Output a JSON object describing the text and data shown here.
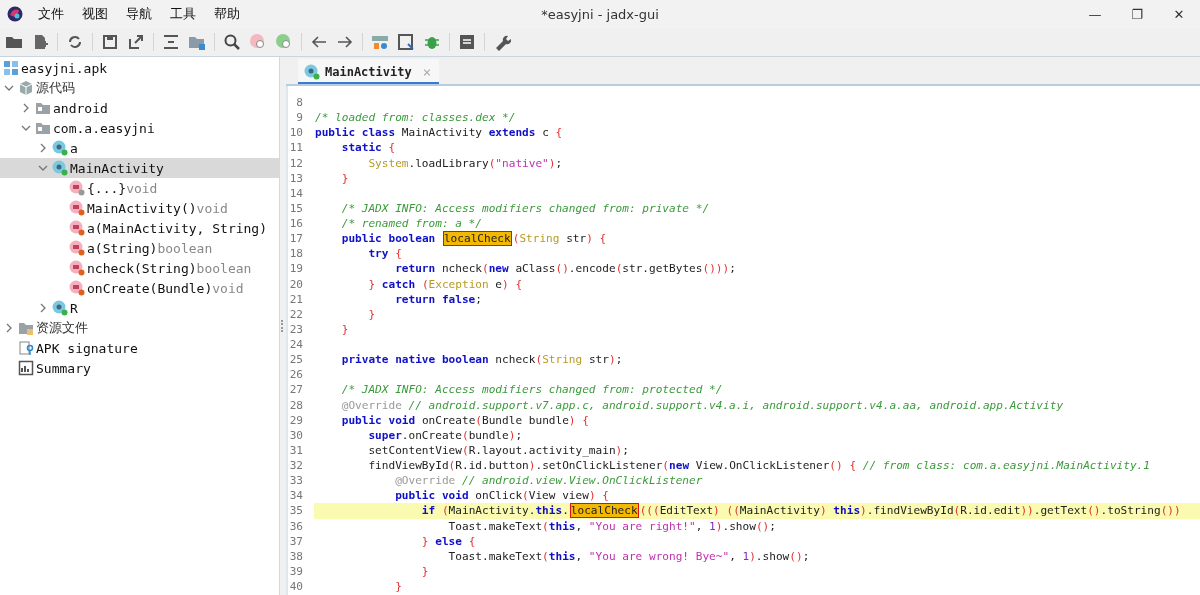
{
  "window": {
    "title": "*easyjni - jadx-gui",
    "controls": [
      "—",
      "❐",
      "✕"
    ]
  },
  "menu": [
    "文件",
    "视图",
    "导航",
    "工具",
    "帮助"
  ],
  "tree": {
    "root": {
      "label": "easyjni.apk"
    },
    "items": [
      {
        "label": "源代码",
        "kind": "source",
        "expanded": true,
        "selected": false,
        "children": [
          {
            "label": "android",
            "kind": "package",
            "expanded": false,
            "selected": false
          },
          {
            "label": "com.a.easyjni",
            "kind": "package",
            "expanded": true,
            "selected": false,
            "children": [
              {
                "label": "a",
                "kind": "class",
                "expanded": false,
                "selected": false
              },
              {
                "label": "MainActivity",
                "kind": "class",
                "expanded": true,
                "selected": true,
                "children": [
                  {
                    "label": "{...}",
                    "type_hint": "void",
                    "kind": "init",
                    "selected": false
                  },
                  {
                    "label": "MainActivity()",
                    "type_hint": "void",
                    "kind": "method",
                    "selected": false
                  },
                  {
                    "label": "a(MainActivity, String)",
                    "kind": "method",
                    "selected": false
                  },
                  {
                    "label": "a(String)",
                    "type_hint": "boolean",
                    "kind": "method",
                    "selected": false
                  },
                  {
                    "label": "ncheck(String)",
                    "type_hint": "boolean",
                    "kind": "method",
                    "selected": false
                  },
                  {
                    "label": "onCreate(Bundle)",
                    "type_hint": "void",
                    "kind": "method",
                    "selected": false
                  }
                ]
              },
              {
                "label": "R",
                "kind": "class",
                "expanded": false,
                "selected": false
              }
            ]
          }
        ]
      },
      {
        "label": "资源文件",
        "kind": "resources",
        "expanded": false,
        "selected": false
      },
      {
        "label": "APK signature",
        "kind": "signature",
        "selected": false
      },
      {
        "label": "Summary",
        "kind": "summary",
        "selected": false
      }
    ]
  },
  "tabs": [
    {
      "label": "MainActivity",
      "close": "×",
      "selected": true
    }
  ],
  "code": {
    "lines": [
      {
        "number": "8",
        "current": false
      },
      {
        "number": "9",
        "current": false,
        "tokens": [
          {
            "kind": "comment",
            "text": "/* loaded from: classes.dex */"
          }
        ]
      },
      {
        "number": "10",
        "current": false,
        "tokens": [
          {
            "kind": "keyword",
            "text": "public "
          },
          {
            "kind": "keyword",
            "text": "class"
          },
          {
            "kind": "plain",
            "text": " MainActivity "
          },
          {
            "kind": "keyword",
            "text": "extends"
          },
          {
            "kind": "plain",
            "text": " c "
          },
          {
            "kind": "paren",
            "text": "{"
          }
        ]
      },
      {
        "number": "11",
        "current": false,
        "tokens": [
          {
            "kind": "keyword",
            "text": "    static "
          },
          {
            "kind": "paren",
            "text": "{"
          }
        ]
      },
      {
        "number": "12",
        "current": false,
        "tokens": [
          {
            "kind": "type",
            "text": "        System"
          },
          {
            "kind": "plain",
            "text": ".loadLibrary"
          },
          {
            "kind": "paren",
            "text": "("
          },
          {
            "kind": "string",
            "text": "\"native\""
          },
          {
            "kind": "paren",
            "text": ")"
          },
          {
            "kind": "plain",
            "text": ";"
          }
        ]
      },
      {
        "number": "13",
        "current": false,
        "tokens": [
          {
            "kind": "paren",
            "text": "    }"
          }
        ]
      },
      {
        "number": "14",
        "current": false
      },
      {
        "number": "15",
        "current": false,
        "tokens": [
          {
            "kind": "comment",
            "text": "    /* JADX INFO: Access modifiers changed from: private */"
          }
        ]
      },
      {
        "number": "16",
        "current": false,
        "tokens": [
          {
            "kind": "comment",
            "text": "    /* renamed from: a */"
          }
        ]
      },
      {
        "number": "17",
        "current": false,
        "tokens": [
          {
            "kind": "keyword",
            "text": "    public "
          },
          {
            "kind": "keyword",
            "text": "boolean "
          },
          {
            "kind": "match",
            "text": "localCheck"
          },
          {
            "kind": "paren",
            "text": "("
          },
          {
            "kind": "type",
            "text": "String"
          },
          {
            "kind": "plain",
            "text": " str"
          },
          {
            "kind": "paren",
            "text": ") {"
          }
        ]
      },
      {
        "number": "18",
        "current": false,
        "tokens": [
          {
            "kind": "keyword",
            "text": "        try "
          },
          {
            "kind": "paren",
            "text": "{"
          }
        ]
      },
      {
        "number": "19",
        "current": false,
        "tokens": [
          {
            "kind": "keyword",
            "text": "            return"
          },
          {
            "kind": "plain",
            "text": " ncheck"
          },
          {
            "kind": "paren",
            "text": "("
          },
          {
            "kind": "keyword",
            "text": "new"
          },
          {
            "kind": "plain",
            "text": " aClass"
          },
          {
            "kind": "paren",
            "text": "()"
          },
          {
            "kind": "plain",
            "text": ".encode"
          },
          {
            "kind": "paren",
            "text": "("
          },
          {
            "kind": "plain",
            "text": "str.getBytes"
          },
          {
            "kind": "paren",
            "text": "()))"
          },
          {
            "kind": "plain",
            "text": ";"
          }
        ]
      },
      {
        "number": "20",
        "current": false,
        "tokens": [
          {
            "kind": "paren",
            "text": "        } "
          },
          {
            "kind": "keyword",
            "text": "catch "
          },
          {
            "kind": "paren",
            "text": "("
          },
          {
            "kind": "type",
            "text": "Exception"
          },
          {
            "kind": "plain",
            "text": " e"
          },
          {
            "kind": "paren",
            "text": ") {"
          }
        ]
      },
      {
        "number": "21",
        "current": false,
        "tokens": [
          {
            "kind": "keyword",
            "text": "            return "
          },
          {
            "kind": "keyword",
            "text": "false"
          },
          {
            "kind": "plain",
            "text": ";"
          }
        ]
      },
      {
        "number": "22",
        "current": false,
        "tokens": [
          {
            "kind": "paren",
            "text": "        }"
          }
        ]
      },
      {
        "number": "23",
        "current": false,
        "tokens": [
          {
            "kind": "paren",
            "text": "    }"
          }
        ]
      },
      {
        "number": "24",
        "current": false
      },
      {
        "number": "25",
        "current": false,
        "tokens": [
          {
            "kind": "keyword",
            "text": "    private "
          },
          {
            "kind": "keyword",
            "text": "native "
          },
          {
            "kind": "keyword",
            "text": "boolean"
          },
          {
            "kind": "plain",
            "text": " ncheck"
          },
          {
            "kind": "paren",
            "text": "("
          },
          {
            "kind": "type",
            "text": "String"
          },
          {
            "kind": "plain",
            "text": " str"
          },
          {
            "kind": "paren",
            "text": ")"
          },
          {
            "kind": "plain",
            "text": ";"
          }
        ]
      },
      {
        "number": "26",
        "current": false
      },
      {
        "number": "27",
        "current": false,
        "tokens": [
          {
            "kind": "comment",
            "text": "    /* JADX INFO: Access modifiers changed from: protected */"
          }
        ]
      },
      {
        "number": "28",
        "current": false,
        "tokens": [
          {
            "kind": "annotation",
            "text": "    @Override "
          },
          {
            "kind": "comment",
            "text": "// android.support.v7.app.c, android.support.v4.a.i, android.support.v4.a.aa, android.app.Activity"
          }
        ]
      },
      {
        "number": "29",
        "current": false,
        "tokens": [
          {
            "kind": "keyword",
            "text": "    public "
          },
          {
            "kind": "keyword",
            "text": "void"
          },
          {
            "kind": "plain",
            "text": " onCreate"
          },
          {
            "kind": "paren",
            "text": "("
          },
          {
            "kind": "plain",
            "text": "Bundle bundle"
          },
          {
            "kind": "paren",
            "text": ") {"
          }
        ]
      },
      {
        "number": "30",
        "current": false,
        "tokens": [
          {
            "kind": "keyword",
            "text": "        super"
          },
          {
            "kind": "plain",
            "text": ".onCreate"
          },
          {
            "kind": "paren",
            "text": "("
          },
          {
            "kind": "plain",
            "text": "bundle"
          },
          {
            "kind": "paren",
            "text": ")"
          },
          {
            "kind": "plain",
            "text": ";"
          }
        ]
      },
      {
        "number": "31",
        "current": false,
        "tokens": [
          {
            "kind": "plain",
            "text": "        setContentView"
          },
          {
            "kind": "paren",
            "text": "("
          },
          {
            "kind": "plain",
            "text": "R.layout.activity_main"
          },
          {
            "kind": "paren",
            "text": ")"
          },
          {
            "kind": "plain",
            "text": ";"
          }
        ]
      },
      {
        "number": "32",
        "current": false,
        "tokens": [
          {
            "kind": "plain",
            "text": "        findViewById"
          },
          {
            "kind": "paren",
            "text": "("
          },
          {
            "kind": "plain",
            "text": "R.id.button"
          },
          {
            "kind": "paren",
            "text": ")"
          },
          {
            "kind": "plain",
            "text": ".setOnClickListener"
          },
          {
            "kind": "paren",
            "text": "("
          },
          {
            "kind": "keyword",
            "text": "new"
          },
          {
            "kind": "plain",
            "text": " View.OnClickListener"
          },
          {
            "kind": "paren",
            "text": "() { "
          },
          {
            "kind": "comment",
            "text": "// from class: com.a.easyjni.MainActivity.1"
          }
        ]
      },
      {
        "number": "33",
        "current": false,
        "tokens": [
          {
            "kind": "annotation",
            "text": "            @Override "
          },
          {
            "kind": "comment",
            "text": "// android.view.View.OnClickListener"
          }
        ]
      },
      {
        "number": "34",
        "current": false,
        "tokens": [
          {
            "kind": "keyword",
            "text": "            public "
          },
          {
            "kind": "keyword",
            "text": "void"
          },
          {
            "kind": "plain",
            "text": " onClick"
          },
          {
            "kind": "paren",
            "text": "("
          },
          {
            "kind": "plain",
            "text": "View view"
          },
          {
            "kind": "paren",
            "text": ") {"
          }
        ]
      },
      {
        "number": "35",
        "current": true,
        "tokens": [
          {
            "kind": "keyword",
            "text": "                if "
          },
          {
            "kind": "paren",
            "text": "("
          },
          {
            "kind": "plain",
            "text": "MainActivity."
          },
          {
            "kind": "keyword",
            "text": "this"
          },
          {
            "kind": "plain",
            "text": "."
          },
          {
            "kind": "match",
            "text": "localCheck"
          },
          {
            "kind": "paren",
            "text": "((("
          },
          {
            "kind": "plain",
            "text": "EditText"
          },
          {
            "kind": "paren",
            "text": ") (("
          },
          {
            "kind": "plain",
            "text": "MainActivity"
          },
          {
            "kind": "paren",
            "text": ") "
          },
          {
            "kind": "keyword",
            "text": "this"
          },
          {
            "kind": "paren",
            "text": ")"
          },
          {
            "kind": "plain",
            "text": ".findViewById"
          },
          {
            "kind": "paren",
            "text": "("
          },
          {
            "kind": "plain",
            "text": "R.id.edit"
          },
          {
            "kind": "paren",
            "text": "))"
          },
          {
            "kind": "plain",
            "text": ".getText"
          },
          {
            "kind": "paren",
            "text": "()"
          },
          {
            "kind": "plain",
            "text": ".toString"
          },
          {
            "kind": "paren",
            "text": "())"
          }
        ]
      },
      {
        "number": "36",
        "current": false,
        "tokens": [
          {
            "kind": "plain",
            "text": "                    Toast.makeText"
          },
          {
            "kind": "paren",
            "text": "("
          },
          {
            "kind": "keyword",
            "text": "this"
          },
          {
            "kind": "plain",
            "text": ", "
          },
          {
            "kind": "string",
            "text": "\"You are right!\""
          },
          {
            "kind": "plain",
            "text": ", "
          },
          {
            "kind": "number",
            "text": "1"
          },
          {
            "kind": "paren",
            "text": ")"
          },
          {
            "kind": "plain",
            "text": ".show"
          },
          {
            "kind": "paren",
            "text": "()"
          },
          {
            "kind": "plain",
            "text": ";"
          }
        ]
      },
      {
        "number": "37",
        "current": false,
        "tokens": [
          {
            "kind": "paren",
            "text": "                } "
          },
          {
            "kind": "keyword",
            "text": "else "
          },
          {
            "kind": "paren",
            "text": "{"
          }
        ]
      },
      {
        "number": "38",
        "current": false,
        "tokens": [
          {
            "kind": "plain",
            "text": "                    Toast.makeText"
          },
          {
            "kind": "paren",
            "text": "("
          },
          {
            "kind": "keyword",
            "text": "this"
          },
          {
            "kind": "plain",
            "text": ", "
          },
          {
            "kind": "string",
            "text": "\"You are wrong! Bye~\""
          },
          {
            "kind": "plain",
            "text": ", "
          },
          {
            "kind": "number",
            "text": "1"
          },
          {
            "kind": "paren",
            "text": ")"
          },
          {
            "kind": "plain",
            "text": ".show"
          },
          {
            "kind": "paren",
            "text": "()"
          },
          {
            "kind": "plain",
            "text": ";"
          }
        ]
      },
      {
        "number": "39",
        "current": false,
        "tokens": [
          {
            "kind": "paren",
            "text": "                }"
          }
        ]
      },
      {
        "number": "40",
        "current": false,
        "tokens": [
          {
            "kind": "paren",
            "text": "            }"
          }
        ]
      }
    ]
  }
}
